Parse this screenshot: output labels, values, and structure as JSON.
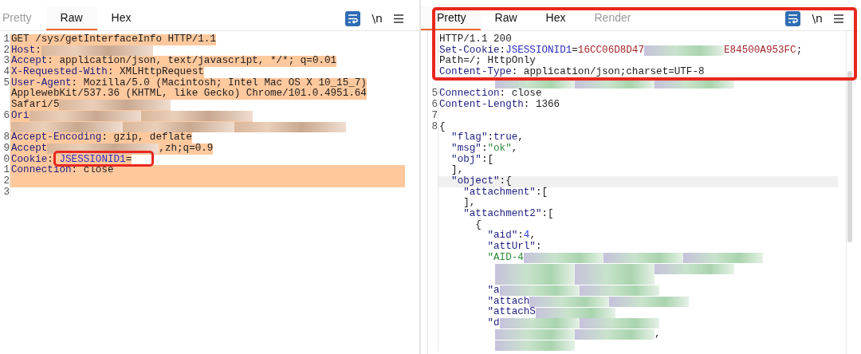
{
  "panes": [
    {
      "kind": "request",
      "tabs": [
        {
          "label": "Pretty",
          "selected": false,
          "disabled": true
        },
        {
          "label": "Raw",
          "selected": true,
          "disabled": false
        },
        {
          "label": "Hex",
          "selected": false,
          "disabled": false
        }
      ],
      "toolbar": {
        "wrap_on": true,
        "newline_label": "\\n"
      },
      "rows": [
        {
          "num": "1",
          "highlighted": true,
          "full_width": false,
          "segs": [
            {
              "kind": "text",
              "text": "GET /sys/getInterfaceInfo HTTP/1.1"
            }
          ]
        },
        {
          "num": "2",
          "highlighted": true,
          "full_width": false,
          "segs": [
            {
              "kind": "key",
              "text": "Host"
            },
            {
              "kind": "text",
              "text": ":"
            },
            {
              "kind": "redacted"
            }
          ]
        },
        {
          "num": "3",
          "highlighted": true,
          "full_width": false,
          "segs": [
            {
              "kind": "key",
              "text": "Accept"
            },
            {
              "kind": "text",
              "text": ": application/json, text/javascript, */*; q=0.01"
            }
          ]
        },
        {
          "num": "4",
          "highlighted": true,
          "full_width": false,
          "segs": [
            {
              "kind": "key",
              "text": "X-Requested-With"
            },
            {
              "kind": "text",
              "text": ": XMLHttpRequest"
            }
          ]
        },
        {
          "num": "5",
          "highlighted": true,
          "full_width": false,
          "segs": [
            {
              "kind": "key",
              "text": "User-Agent"
            },
            {
              "kind": "text",
              "text": ": Mozilla/5.0 (Macintosh; Intel Mac OS X 10_15_7)"
            }
          ]
        },
        {
          "num": "",
          "highlighted": true,
          "full_width": false,
          "segs": [
            {
              "kind": "text",
              "text": "ApplewebKit/537.36 (KHTML, like Gecko) Chrome/101.0.4951.64"
            }
          ]
        },
        {
          "num": "",
          "highlighted": true,
          "full_width": false,
          "segs": [
            {
              "kind": "text",
              "text": "Safari/5"
            },
            {
              "kind": "redacted"
            }
          ]
        },
        {
          "num": "6",
          "highlighted": true,
          "full_width": false,
          "segs": [
            {
              "kind": "key",
              "text": "Ori"
            },
            {
              "kind": "redacted"
            },
            {
              "kind": "redacted"
            }
          ]
        },
        {
          "num": "",
          "highlighted": true,
          "full_width": false,
          "segs": [
            {
              "kind": "redacted"
            },
            {
              "kind": "redacted"
            },
            {
              "kind": "redacted"
            }
          ]
        },
        {
          "num": "8",
          "highlighted": true,
          "full_width": false,
          "segs": [
            {
              "kind": "key",
              "text": "Accept-Encoding"
            },
            {
              "kind": "text",
              "text": ": gzip, deflate"
            }
          ]
        },
        {
          "num": "9",
          "highlighted": true,
          "full_width": false,
          "segs": [
            {
              "kind": "key",
              "text": "Accept"
            },
            {
              "kind": "redacted"
            },
            {
              "kind": "text",
              "text": ",zh;q=0.9"
            }
          ]
        },
        {
          "num": "0",
          "highlighted": true,
          "full_width": false,
          "segs": [
            {
              "kind": "key",
              "text": "Cookie"
            },
            {
              "kind": "text",
              "text": ": "
            },
            {
              "kind": "link",
              "text": "JSESSIONID1"
            },
            {
              "kind": "text",
              "text": "="
            }
          ]
        },
        {
          "num": "1",
          "highlighted": true,
          "full_width": true,
          "segs": [
            {
              "kind": "key",
              "text": "Connection"
            },
            {
              "kind": "text",
              "text": ": close"
            }
          ]
        },
        {
          "num": "2",
          "highlighted": true,
          "full_width": true,
          "segs": []
        },
        {
          "num": "3",
          "highlighted": false,
          "segs": []
        }
      ]
    },
    {
      "kind": "response",
      "tabs": [
        {
          "label": "Pretty",
          "selected": true,
          "disabled": false
        },
        {
          "label": "Raw",
          "selected": false,
          "disabled": false
        },
        {
          "label": "Hex",
          "selected": false,
          "disabled": false
        },
        {
          "label": "Render",
          "selected": false,
          "disabled": true
        }
      ],
      "toolbar": {
        "wrap_on": true,
        "newline_label": "\\n"
      },
      "rows": [
        {
          "num": "",
          "current": false,
          "segs": [
            {
              "kind": "text",
              "text": "HTTP/1.1 200"
            }
          ]
        },
        {
          "num": "",
          "current": false,
          "segs": [
            {
              "kind": "key",
              "text": "Set-Cookie"
            },
            {
              "kind": "text",
              "text": ":"
            },
            {
              "kind": "link",
              "text": "JSESSIONID1"
            },
            {
              "kind": "text",
              "text": "="
            },
            {
              "kind": "cookie",
              "text": "16CC06D8D47"
            },
            {
              "kind": "redacted"
            },
            {
              "kind": "cookie",
              "text": "E84500A953FC"
            },
            {
              "kind": "text",
              "text": ";"
            }
          ]
        },
        {
          "num": "",
          "current": false,
          "segs": [
            {
              "kind": "text",
              "text": "Path=/; HttpOnly"
            }
          ]
        },
        {
          "num": "",
          "current": false,
          "segs": [
            {
              "kind": "key",
              "text": "Content-Type"
            },
            {
              "kind": "text",
              "text": ": application/json;charset=UTF-8"
            }
          ]
        },
        {
          "num": "",
          "current": false,
          "segs": [
            {
              "kind": "redacted"
            },
            {
              "kind": "redacted"
            },
            {
              "kind": "redacted"
            }
          ]
        },
        {
          "num": "5",
          "current": false,
          "segs": [
            {
              "kind": "key",
              "text": "Connection"
            },
            {
              "kind": "text",
              "text": ": close"
            }
          ]
        },
        {
          "num": "6",
          "current": false,
          "segs": [
            {
              "kind": "key",
              "text": "Content-Length"
            },
            {
              "kind": "text",
              "text": ": 1366"
            }
          ]
        },
        {
          "num": "7",
          "current": false,
          "segs": []
        },
        {
          "num": "8",
          "current": false,
          "segs": [
            {
              "kind": "text",
              "text": "{"
            }
          ]
        },
        {
          "num": "",
          "current": false,
          "segs": [
            {
              "kind": "key",
              "text": "  \"flag\""
            },
            {
              "kind": "text",
              "text": ":"
            },
            {
              "kind": "literal",
              "text": "true"
            },
            {
              "kind": "text",
              "text": ","
            }
          ]
        },
        {
          "num": "",
          "current": false,
          "segs": [
            {
              "kind": "key",
              "text": "  \"msg\""
            },
            {
              "kind": "text",
              "text": ":"
            },
            {
              "kind": "string",
              "text": "\"ok\""
            },
            {
              "kind": "text",
              "text": ","
            }
          ]
        },
        {
          "num": "",
          "current": false,
          "segs": [
            {
              "kind": "key",
              "text": "  \"obj\""
            },
            {
              "kind": "text",
              "text": ":["
            }
          ]
        },
        {
          "num": "",
          "current": false,
          "segs": [
            {
              "kind": "text",
              "text": "  ],"
            }
          ]
        },
        {
          "num": "",
          "current": true,
          "segs": [
            {
              "kind": "key",
              "text": "  \"object\""
            },
            {
              "kind": "text",
              "text": ":{"
            }
          ]
        },
        {
          "num": "",
          "current": false,
          "segs": [
            {
              "kind": "key",
              "text": "    \"attachment\""
            },
            {
              "kind": "text",
              "text": ":["
            }
          ]
        },
        {
          "num": "",
          "current": false,
          "segs": [
            {
              "kind": "text",
              "text": "    ],"
            }
          ]
        },
        {
          "num": "",
          "current": false,
          "segs": [
            {
              "kind": "key",
              "text": "    \"attachment2\""
            },
            {
              "kind": "text",
              "text": ":["
            }
          ]
        },
        {
          "num": "",
          "current": false,
          "segs": [
            {
              "kind": "text",
              "text": "      {"
            }
          ]
        },
        {
          "num": "",
          "current": false,
          "segs": [
            {
              "kind": "key",
              "text": "        \"aid\""
            },
            {
              "kind": "text",
              "text": ":"
            },
            {
              "kind": "number",
              "text": "4"
            },
            {
              "kind": "text",
              "text": ","
            }
          ]
        },
        {
          "num": "",
          "current": false,
          "segs": [
            {
              "kind": "key",
              "text": "        \"attUrl\""
            },
            {
              "kind": "text",
              "text": ":"
            }
          ]
        },
        {
          "num": "",
          "current": false,
          "segs": [
            {
              "kind": "string",
              "text": "        \"AID-4"
            },
            {
              "kind": "redacted"
            },
            {
              "kind": "redacted"
            },
            {
              "kind": "redacted"
            }
          ]
        },
        {
          "num": "",
          "current": false,
          "segs": [
            {
              "kind": "redacted"
            },
            {
              "kind": "redacted"
            },
            {
              "kind": "redacted"
            }
          ]
        },
        {
          "num": "",
          "current": false,
          "segs": [
            {
              "kind": "redacted"
            },
            {
              "kind": "redacted"
            }
          ]
        },
        {
          "num": "",
          "current": false,
          "segs": [
            {
              "kind": "key",
              "text": "        \"a"
            },
            {
              "kind": "redacted"
            },
            {
              "kind": "redacted"
            }
          ]
        },
        {
          "num": "",
          "current": false,
          "segs": [
            {
              "kind": "key",
              "text": "        \"attach"
            },
            {
              "kind": "redacted"
            },
            {
              "kind": "redacted"
            }
          ]
        },
        {
          "num": "",
          "current": false,
          "segs": [
            {
              "kind": "key",
              "text": "        \"attachS"
            },
            {
              "kind": "redacted"
            }
          ]
        },
        {
          "num": "",
          "current": false,
          "segs": [
            {
              "kind": "key",
              "text": "        \"d"
            },
            {
              "kind": "redacted"
            },
            {
              "kind": "redacted"
            }
          ]
        },
        {
          "num": "",
          "current": false,
          "segs": [
            {
              "kind": "redacted"
            },
            {
              "kind": "redacted"
            },
            {
              "kind": "text",
              "text": ","
            }
          ]
        },
        {
          "num": "",
          "current": false,
          "segs": [
            {
              "kind": "redacted"
            }
          ]
        }
      ]
    }
  ]
}
